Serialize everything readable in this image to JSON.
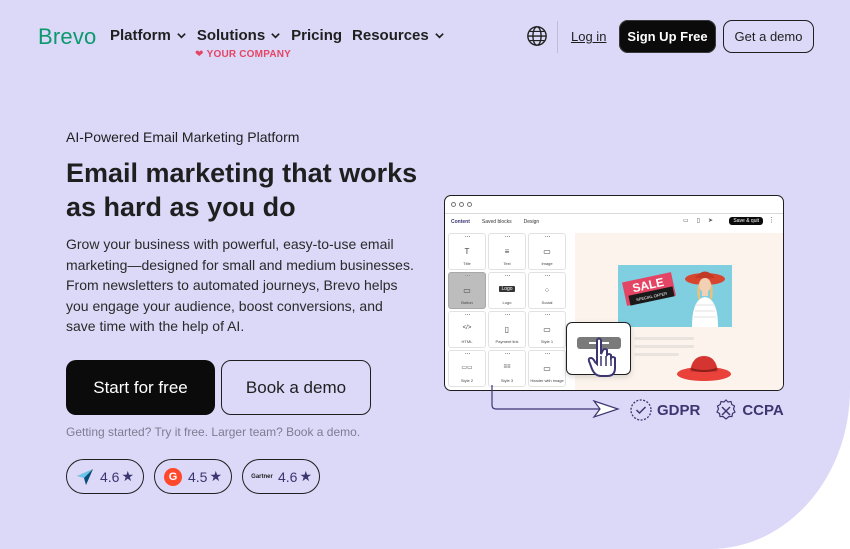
{
  "brand": {
    "logo_text": "Brevo",
    "accent": "#0b996e"
  },
  "nav": {
    "items": [
      {
        "label": "Platform",
        "has_dropdown": true
      },
      {
        "label": "Solutions",
        "has_dropdown": true
      },
      {
        "label": "Pricing",
        "has_dropdown": false
      },
      {
        "label": "Resources",
        "has_dropdown": true
      }
    ],
    "globe_icon": "globe-icon",
    "login_label": "Log in",
    "signup_label": "Sign Up Free",
    "demo_label": "Get a demo"
  },
  "hero": {
    "eyebrow": "AI-Powered Email Marketing Platform",
    "headline": "Email marketing that works as hard as you do",
    "description": "Grow your business with powerful, easy-to-use email marketing—designed for small and medium businesses. From newsletters to automated journeys, Brevo helps you engage your audience, boost conversions, and save time with the help of AI.",
    "cta_primary": "Start for free",
    "cta_secondary": "Book a demo",
    "helper_text": "Getting started? Try it free. Larger team? Book a demo."
  },
  "ratings": [
    {
      "source_icon": "capterra-icon",
      "score": "4.6",
      "star": "★"
    },
    {
      "source_icon": "g2-icon",
      "source_text": "G",
      "score": "4.5",
      "star": "★"
    },
    {
      "source_icon": "gartner-icon",
      "source_text": "Gartner",
      "score": "4.6",
      "star": "★"
    }
  ],
  "editor_mockup": {
    "tabs": [
      "Content",
      "Saved blocks",
      "Design"
    ],
    "save_label": "Save & quit",
    "blocks": [
      {
        "label": "Title",
        "icon": "T"
      },
      {
        "label": "Text",
        "icon": "≡"
      },
      {
        "label": "Image",
        "icon": "▭"
      },
      {
        "label": "Button",
        "icon": "▭"
      },
      {
        "label": "Logo",
        "icon": "Logo"
      },
      {
        "label": "Social",
        "icon": "⁘"
      },
      {
        "label": "HTML",
        "icon": "</>"
      },
      {
        "label": "Payment link",
        "icon": "▯"
      },
      {
        "label": "Style 1",
        "icon": "▭"
      },
      {
        "label": "Style 2",
        "icon": "▭▭"
      },
      {
        "label": "Style 3",
        "icon": "≡≡"
      },
      {
        "label": "Header with image",
        "icon": "▭"
      }
    ],
    "company_name": "YOUR COMPANY",
    "sale_text": "SALE",
    "special_offer_text": "SPECIAL OFFER",
    "brand_pink": "#e54565"
  },
  "compliance": [
    {
      "label": "GDPR",
      "icon": "gdpr-shield-icon"
    },
    {
      "label": "CCPA",
      "icon": "ccpa-shield-icon"
    }
  ],
  "colors": {
    "hero_bg": "#dcd8f8",
    "dark": "#0b0b0b",
    "rating_text": "#3b3670"
  }
}
